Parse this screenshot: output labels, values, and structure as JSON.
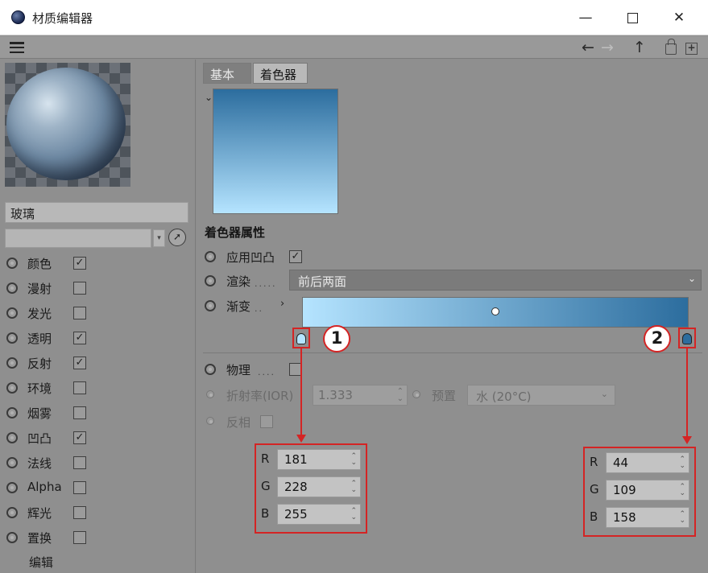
{
  "window": {
    "title": "材质编辑器",
    "icon": "cinema4d-logo-icon",
    "controls": {
      "minimize": "—",
      "close": "✕"
    }
  },
  "menubar": {
    "nav_back": "←",
    "nav_forward": "→",
    "nav_up": "↑",
    "new_symbol": "+"
  },
  "left_panel": {
    "material_name": "玻璃",
    "channels": [
      {
        "label": "颜色",
        "checked": true
      },
      {
        "label": "漫射",
        "checked": false
      },
      {
        "label": "发光",
        "checked": false
      },
      {
        "label": "透明",
        "checked": true
      },
      {
        "label": "反射",
        "checked": true
      },
      {
        "label": "环境",
        "checked": false
      },
      {
        "label": "烟雾",
        "checked": false
      },
      {
        "label": "凹凸",
        "checked": true
      },
      {
        "label": "法线",
        "checked": false
      },
      {
        "label": "Alpha",
        "checked": false
      },
      {
        "label": "辉光",
        "checked": false
      },
      {
        "label": "置换",
        "checked": false
      }
    ],
    "edit_label": "编辑"
  },
  "right_panel": {
    "tabs": [
      {
        "label": "基本",
        "active": false
      },
      {
        "label": "着色器",
        "active": true
      }
    ],
    "section_title": "着色器属性",
    "apply_bump_label": "应用凹凸",
    "apply_bump_checked": true,
    "render_label": "渲染",
    "render_value": "前后两面",
    "gradient_label": "渐变",
    "gradient_start_color": "#b5e4ff",
    "gradient_end_color": "#2c6d9e",
    "physical_label": "物理",
    "ior_label": "折射率(IOR)",
    "ior_value": "1.333",
    "preset_label": "预置",
    "preset_value": "水 (20°C)",
    "invert_label": "反相"
  },
  "callouts": [
    {
      "marker": "1",
      "r": "181",
      "g": "228",
      "b": "255"
    },
    {
      "marker": "2",
      "r": "44",
      "g": "109",
      "b": "158"
    }
  ],
  "rgb_letters": {
    "r": "R",
    "g": "G",
    "b": "B"
  },
  "colors": {
    "accent_red": "#d42424",
    "panel_gray": "#8f8f8f"
  }
}
